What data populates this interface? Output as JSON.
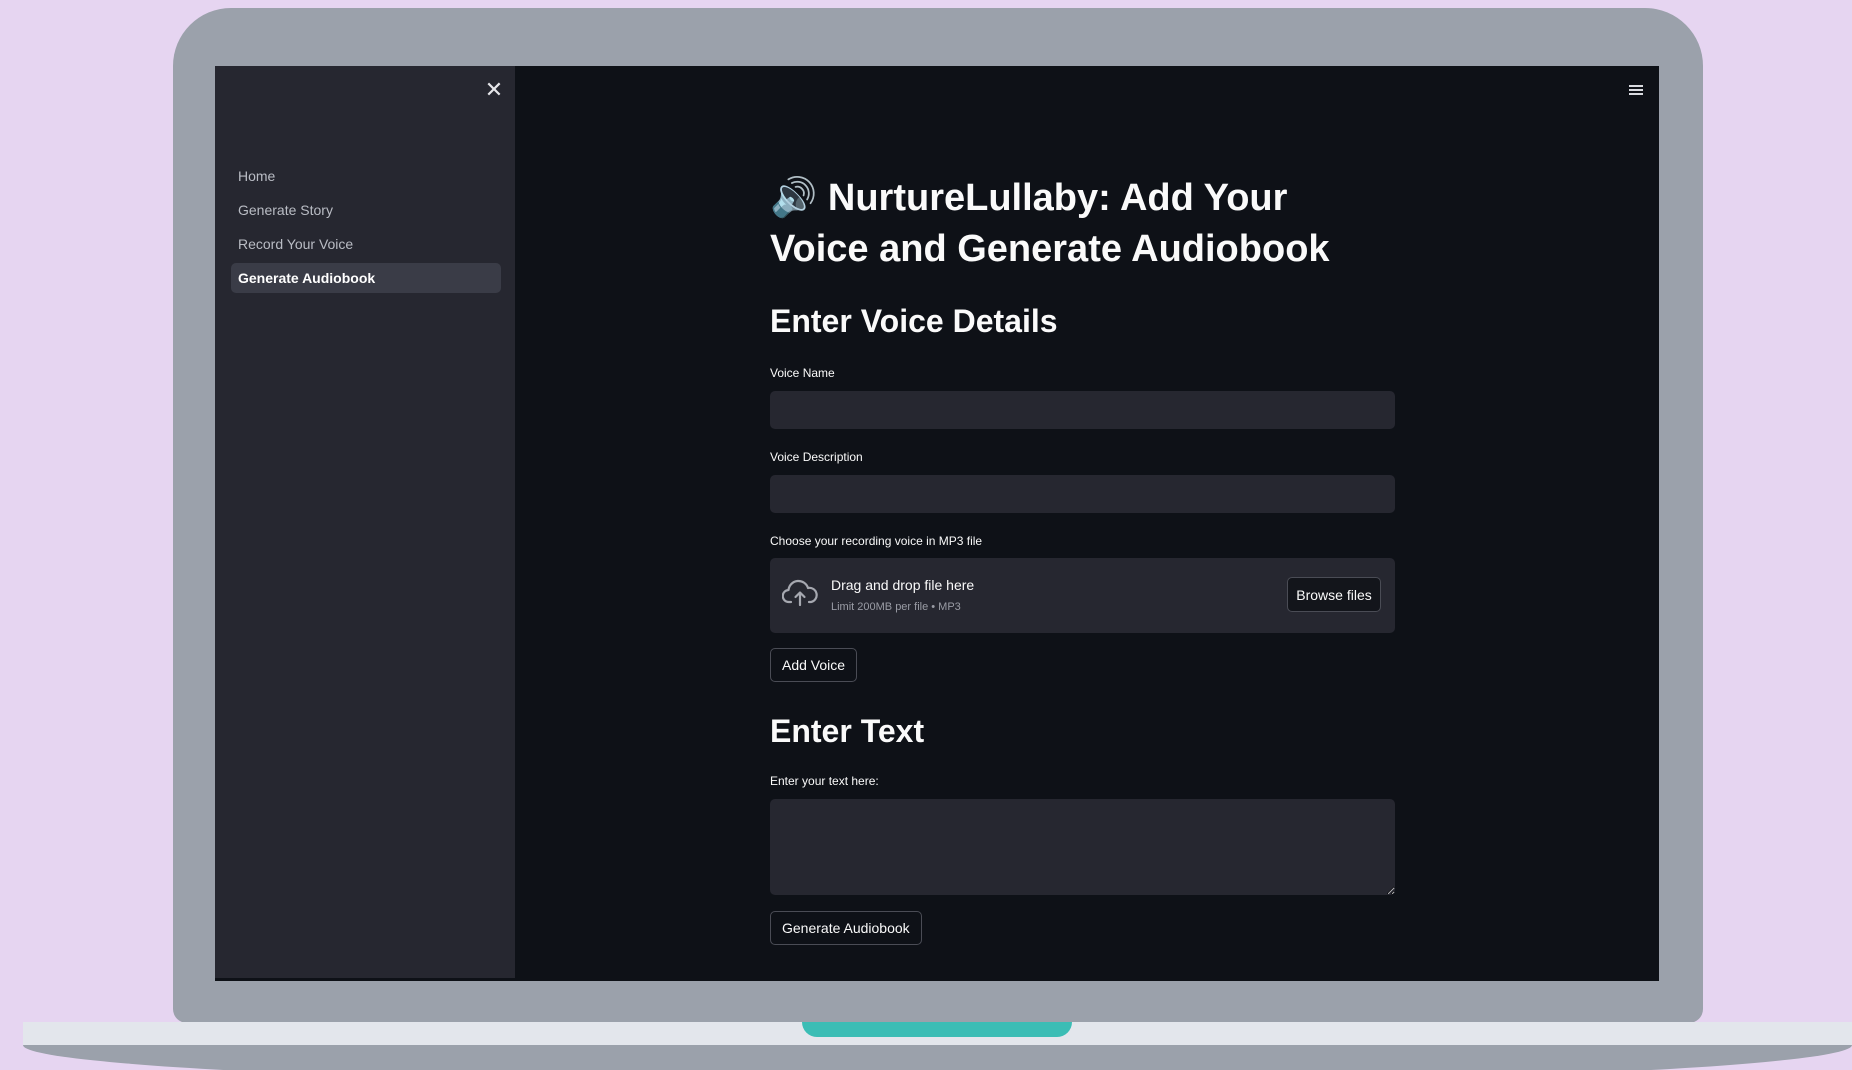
{
  "sidebar": {
    "close_icon": "close-icon",
    "items": [
      {
        "label": "Home"
      },
      {
        "label": "Generate Story"
      },
      {
        "label": "Record Your Voice"
      },
      {
        "label": "Generate Audiobook",
        "active": true
      }
    ]
  },
  "header": {
    "menu_icon": "hamburger-menu-icon"
  },
  "main": {
    "title_icon": "🔊",
    "title": "NurtureLullaby: Add Your Voice and Generate Audiobook",
    "voice_section": {
      "heading": "Enter Voice Details",
      "voice_name_label": "Voice Name",
      "voice_name_value": "",
      "voice_description_label": "Voice Description",
      "voice_description_value": "",
      "file_label": "Choose your recording voice in MP3 file",
      "dropzone_title": "Drag and drop file here",
      "dropzone_limit": "Limit 200MB per file • MP3",
      "browse_label": "Browse files",
      "add_voice_label": "Add Voice"
    },
    "text_section": {
      "heading": "Enter Text",
      "text_label": "Enter your text here:",
      "text_value": "",
      "generate_label": "Generate Audiobook"
    }
  },
  "colors": {
    "background": "#e6d5f1",
    "screen_bg": "#0e1117",
    "sidebar_bg": "#262730",
    "input_bg": "#262730",
    "accent_teal": "#3bbdb5"
  }
}
